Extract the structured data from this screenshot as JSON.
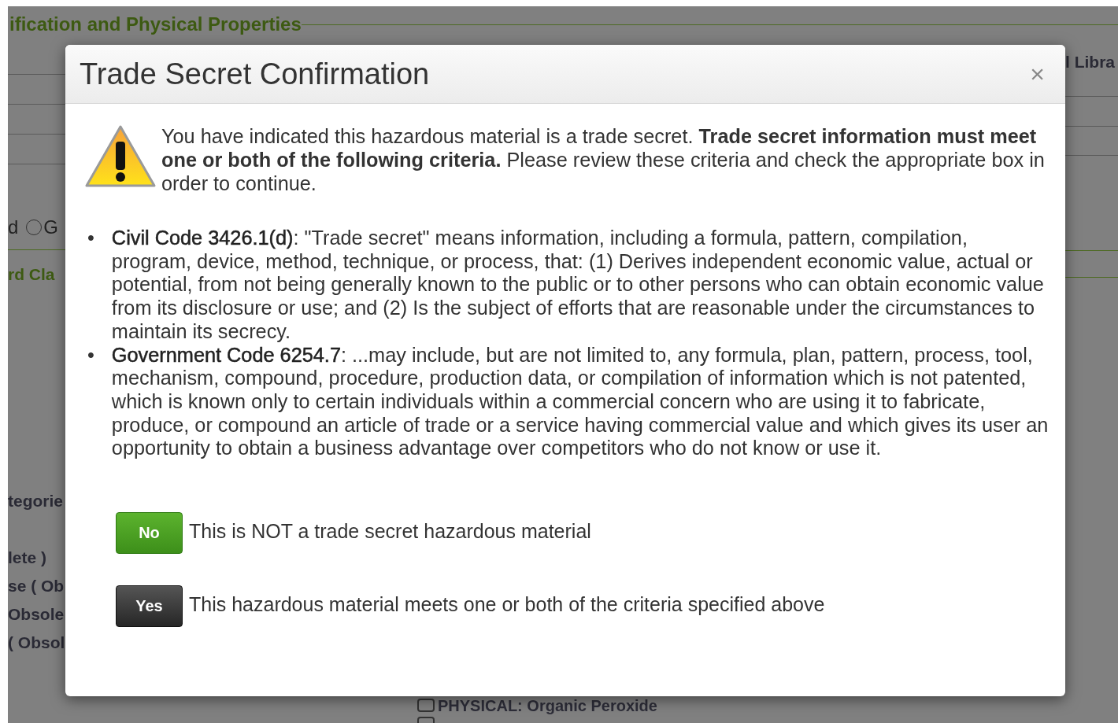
{
  "background": {
    "heading": "ification and Physical Properties",
    "radio_row": {
      "prefix": "d",
      "options": [
        {
          "label": "G",
          "selected": false
        }
      ]
    },
    "subheading": "rd Cla",
    "list_fragments": [
      "tegorie",
      "lete )",
      "se ( Ob",
      "Obsole",
      "( Obsol"
    ],
    "right_fragment": "l Libra",
    "checkboxes": [
      {
        "label": "PHYSICAL: Organic Peroxide",
        "checked": false
      },
      {
        "checked": false
      }
    ]
  },
  "dialog": {
    "title": "Trade Secret Confirmation",
    "close": "×",
    "intro": "You have indicated this hazardous material is a trade secret. **Trade secret information must meet one or both of the following criteria.** Please review these criteria and check the appropriate box in order to continue.",
    "criteria": [
      {
        "marker": "•",
        "term": "Civil Code 3426.1(d)",
        "text": ": \"Trade secret\" means information, including a formula, pattern, compilation, program, device, method, technique, or process, that: (1) Derives independent economic value, actual or potential, from not being generally known to the public or to other persons who can obtain economic value from its disclosure or use; and (2) Is the subject of efforts that are reasonable under the circumstances to maintain its secrecy."
      },
      {
        "marker": "•",
        "term": "Government Code 6254.7",
        "text": ": ...may include, but are not limited to, any formula, plan, pattern, process, tool, mechanism, compound, procedure, production data, or compilation of information which is not patented, which is known only to certain individuals within a commercial concern who are using it to fabricate, produce, or compound an article of trade or a service having commercial value and which gives its user an opportunity to obtain a business advantage over competitors who do not know or use it."
      }
    ],
    "options": [
      {
        "kind": "no",
        "button": "No",
        "label": "This is NOT a trade secret hazardous material"
      },
      {
        "kind": "yes",
        "button": "Yes",
        "label": "This hazardous material meets one or both of the criteria specified above"
      }
    ]
  }
}
